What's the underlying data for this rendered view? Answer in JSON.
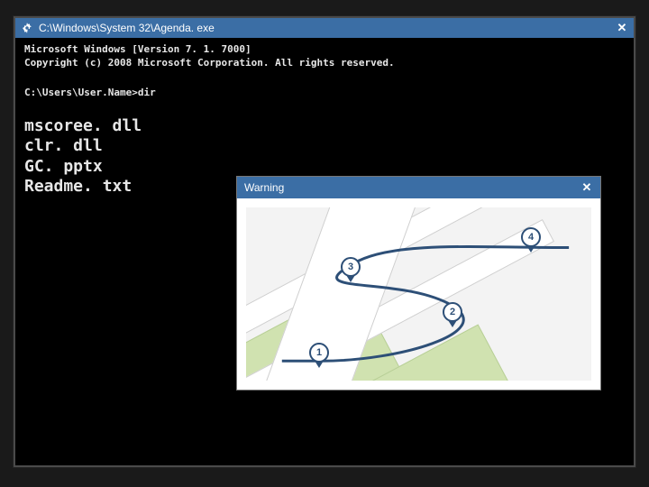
{
  "window": {
    "title": "C:\\Windows\\System 32\\Agenda. exe"
  },
  "console": {
    "version_line": "Microsoft Windows [Version 7. 1. 7000]",
    "copyright_line": "Copyright (c) 2008 Microsoft Corporation.  All rights reserved.",
    "prompt": "C:\\Users\\User.Name>dir",
    "listing": [
      "mscoree. dll",
      "clr. dll",
      "GC. pptx",
      "Readme. txt"
    ]
  },
  "dialog": {
    "title": "Warning",
    "pins": [
      "1",
      "2",
      "3",
      "4"
    ]
  },
  "icons": {
    "close": "✕",
    "gear": "✼"
  }
}
